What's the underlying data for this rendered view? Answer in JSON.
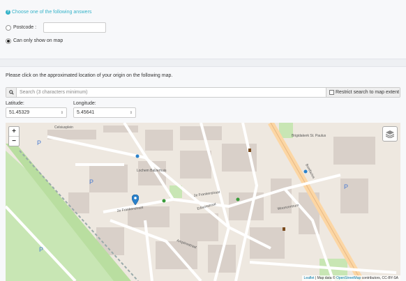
{
  "question": {
    "icon": "question-circle-icon",
    "text": "Choose one of the following answers"
  },
  "options": [
    {
      "label": "Postcode :",
      "selected": false,
      "value": ""
    },
    {
      "label": "Can only show on map",
      "selected": true
    }
  ],
  "instruction": "Please click on the approximated location of your origin on the following map.",
  "search": {
    "icon": "search-icon",
    "placeholder": "Search (3 characters minimum)",
    "restrict_label": "Restrict search to map extent",
    "restrict_checked": false
  },
  "latitude": {
    "label": "Latitude:",
    "value": "51.45329"
  },
  "longitude": {
    "label": "Longitude:",
    "value": "5.45641"
  },
  "map": {
    "zoom_in": "+",
    "zoom_out": "−",
    "layers_icon": "layers-icon",
    "marker_icon": "map-marker-icon",
    "labels": {
      "street_1": "2e Frankenstraat",
      "street_2": "2e Frankenstraat",
      "street_3": "Edisonstraat",
      "street_4": "Ampèrestraat",
      "street_5": "Bonifacius",
      "street_6": "Celsiusplein",
      "street_7": "Brigidakerk St. Paulus",
      "street_8": "Lochem Balzerhuis",
      "street_9": "Wooncentrum"
    },
    "attribution": {
      "leaflet": "Leaflet",
      "text": "| Map data ©",
      "osm": "OpenStreetMap",
      "suffix": "contributors, CC-BY-SA"
    }
  },
  "colors": {
    "accent": "#36b3c9",
    "marker": "#2a81cb",
    "park": "#c8e6b4",
    "road_primary": "#fcd6a4",
    "building": "#d9d0c9"
  }
}
